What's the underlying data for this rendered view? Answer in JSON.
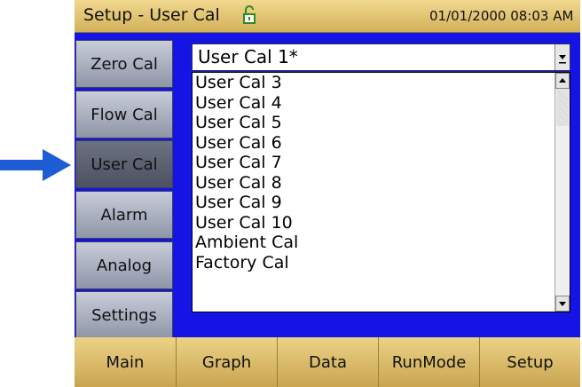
{
  "title_bar": {
    "title": "Setup - User Cal",
    "lock_icon": "unlocked-padlock-icon",
    "datetime": "01/01/2000 08:03 AM"
  },
  "side_menu": {
    "items": [
      {
        "label": "Zero Cal",
        "active": false
      },
      {
        "label": "Flow Cal",
        "active": false
      },
      {
        "label": "User Cal",
        "active": true
      },
      {
        "label": "Alarm",
        "active": false
      },
      {
        "label": "Analog",
        "active": false
      },
      {
        "label": "Settings",
        "active": false
      }
    ]
  },
  "dropdown": {
    "selected": "User Cal 1*",
    "options": [
      "User Cal 3",
      "User Cal 4",
      "User Cal 5",
      "User Cal 6",
      "User Cal 7",
      "User Cal 8",
      "User Cal 9",
      "User Cal 10",
      "Ambient Cal",
      "Factory Cal"
    ]
  },
  "bottom_tabs": [
    "Main",
    "Graph",
    "Data",
    "RunMode",
    "Setup"
  ],
  "annotation": {
    "icon": "blue-arrow-pointer-icon"
  },
  "colors": {
    "background_blue": "#1414e6",
    "header_gold": "#e3c475",
    "annotation_arrow": "#1e5cd6"
  }
}
